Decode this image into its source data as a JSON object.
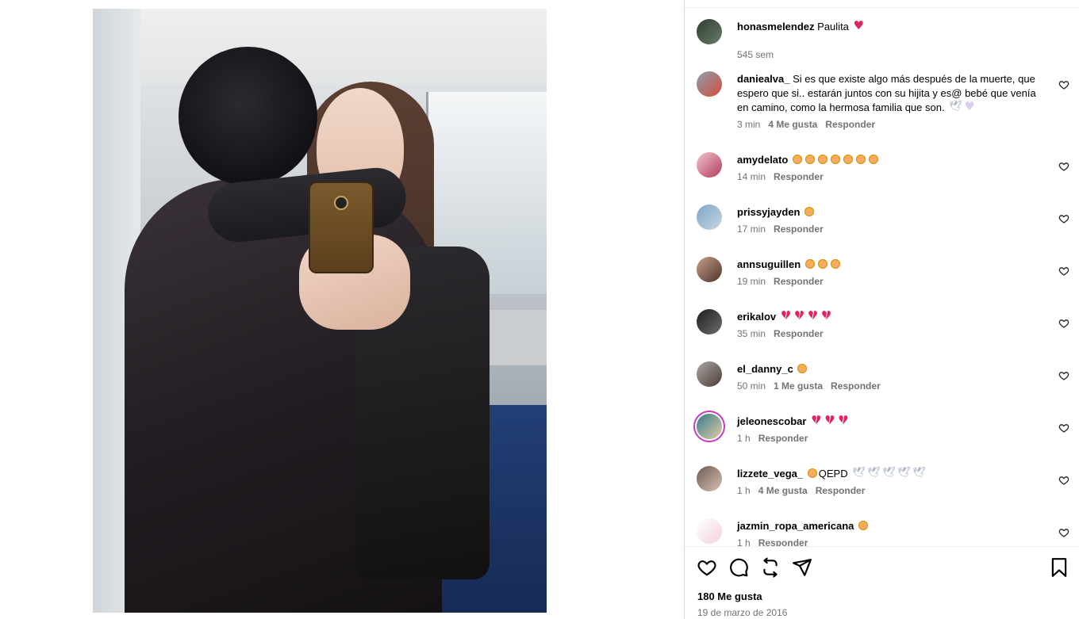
{
  "post": {
    "likes": "180 Me gusta",
    "date": "19 de marzo de 2016"
  },
  "icons": {
    "like": "heart-icon",
    "comment": "comment-icon",
    "share": "share-icon",
    "send": "send-icon",
    "save": "bookmark-icon"
  },
  "comments": [
    {
      "user": "honasmelendez",
      "text": "Paulita",
      "emoji": [
        "heart"
      ],
      "time": "545 sem",
      "likes": "",
      "reply": ""
    },
    {
      "user": "daniealva_",
      "text": "Si es que existe algo más después de la muerte, que espero que si.. estarán juntos con su hijita y es@ bebé que venía en camino, como la hermosa familia que son.",
      "emoji": [
        "dove",
        "lheart"
      ],
      "time": "3 min",
      "likes": "4 Me gusta",
      "reply": "Responder"
    },
    {
      "user": "amydelato",
      "text": "",
      "emoji": [
        "flush",
        "flush",
        "flush",
        "flush",
        "flush",
        "flush",
        "flush"
      ],
      "time": "14 min",
      "likes": "",
      "reply": "Responder"
    },
    {
      "user": "prissyjayden",
      "text": "",
      "emoji": [
        "flush"
      ],
      "time": "17 min",
      "likes": "",
      "reply": "Responder"
    },
    {
      "user": "annsuguillen",
      "text": "",
      "emoji": [
        "flush",
        "flush",
        "flush"
      ],
      "time": "19 min",
      "likes": "",
      "reply": "Responder"
    },
    {
      "user": "erikalov",
      "text": "",
      "emoji": [
        "broken",
        "broken",
        "broken",
        "broken"
      ],
      "time": "35 min",
      "likes": "",
      "reply": "Responder"
    },
    {
      "user": "el_danny_c",
      "text": "",
      "emoji": [
        "flush"
      ],
      "time": "50 min",
      "likes": "1 Me gusta",
      "reply": "Responder"
    },
    {
      "user": "jeleonescobar",
      "text": "",
      "emoji": [
        "broken",
        "broken",
        "broken"
      ],
      "time": "1 h",
      "likes": "",
      "reply": "Responder"
    },
    {
      "user": "lizzete_vega_",
      "text": "QEPD",
      "emoji_before": [
        "flush"
      ],
      "emoji": [
        "dove",
        "dove",
        "dove",
        "dove",
        "dove"
      ],
      "time": "1 h",
      "likes": "4 Me gusta",
      "reply": "Responder"
    },
    {
      "user": "jazmin_ropa_americana",
      "text": "",
      "emoji": [
        "flush"
      ],
      "time": "1 h",
      "likes": "",
      "reply": "Responder"
    }
  ]
}
